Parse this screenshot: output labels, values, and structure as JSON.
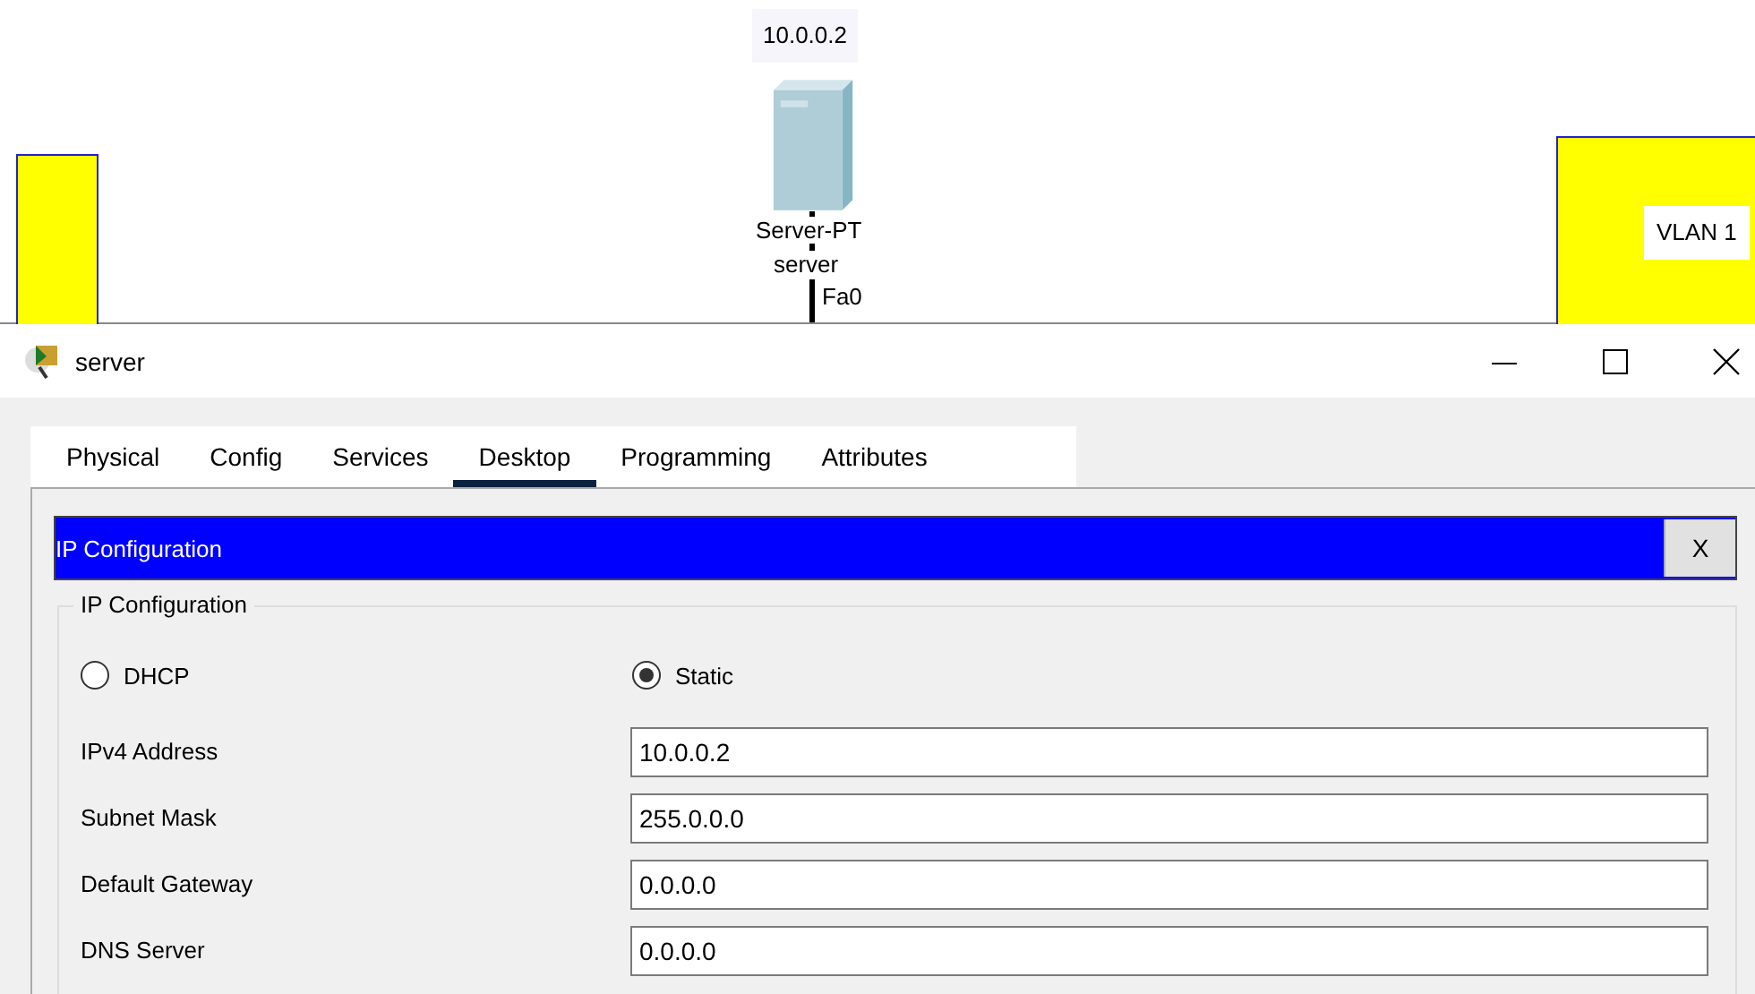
{
  "canvas": {
    "ip_label": "10.0.0.2",
    "device_model": "Server-PT",
    "device_name": "server",
    "port_label": "Fa0",
    "vlan_label": "VLAN 1"
  },
  "window": {
    "title": "server"
  },
  "tabs": [
    {
      "label": "Physical",
      "selected": false
    },
    {
      "label": "Config",
      "selected": false
    },
    {
      "label": "Services",
      "selected": false
    },
    {
      "label": "Desktop",
      "selected": true
    },
    {
      "label": "Programming",
      "selected": false
    },
    {
      "label": "Attributes",
      "selected": false
    }
  ],
  "panel": {
    "title": "IP Configuration",
    "close": "X",
    "group_title": "IP Configuration",
    "modes": [
      {
        "label": "DHCP",
        "selected": false
      },
      {
        "label": "Static",
        "selected": true
      }
    ],
    "fields": [
      {
        "label": "IPv4 Address",
        "value": "10.0.0.2"
      },
      {
        "label": "Subnet Mask",
        "value": "255.0.0.0"
      },
      {
        "label": "Default Gateway",
        "value": "0.0.0.0"
      },
      {
        "label": "DNS Server",
        "value": "0.0.0.0"
      }
    ]
  }
}
